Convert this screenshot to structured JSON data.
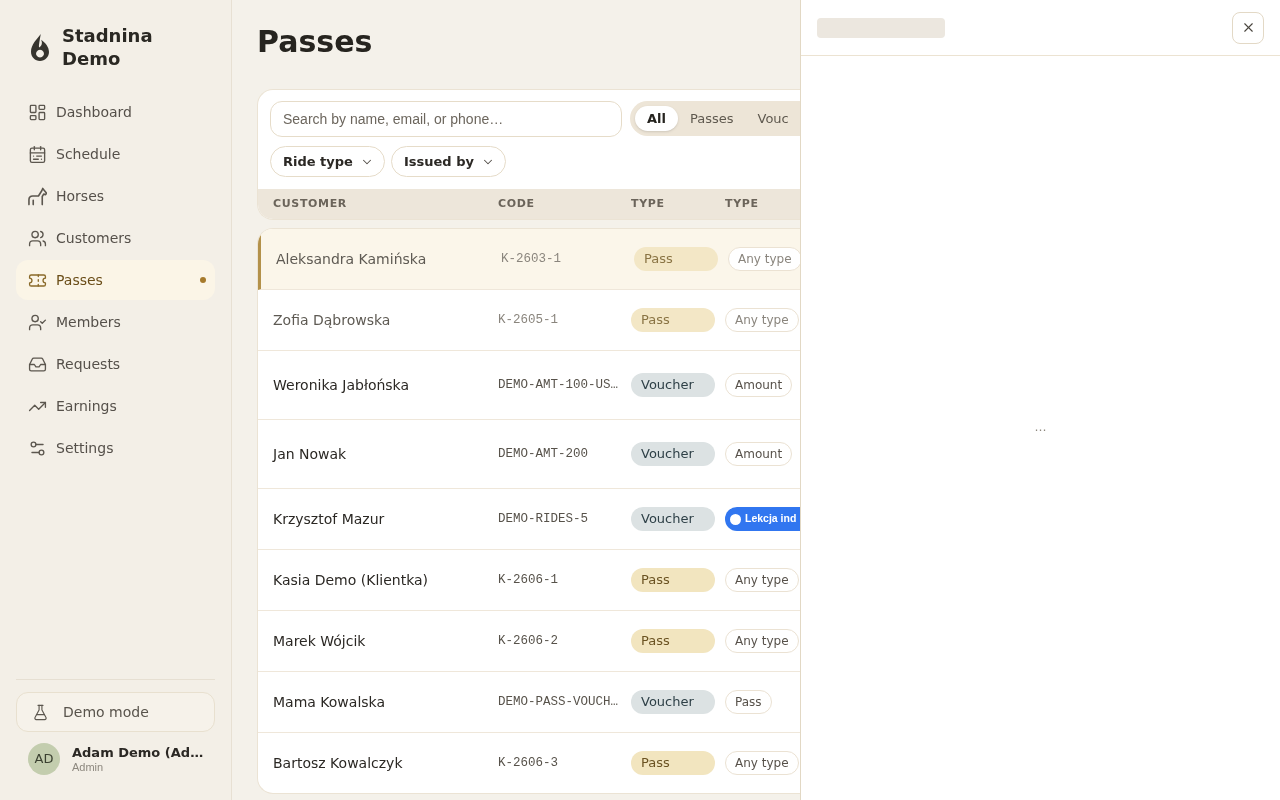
{
  "sidebar": {
    "brand": "Stadnina Demo",
    "items": [
      {
        "label": "Dashboard",
        "selected": false,
        "dot": false
      },
      {
        "label": "Schedule",
        "selected": false,
        "dot": false
      },
      {
        "label": "Horses",
        "selected": false,
        "dot": false
      },
      {
        "label": "Customers",
        "selected": false,
        "dot": false
      },
      {
        "label": "Passes",
        "selected": true,
        "dot": true
      },
      {
        "label": "Members",
        "selected": false,
        "dot": false
      },
      {
        "label": "Requests",
        "selected": false,
        "dot": false
      },
      {
        "label": "Earnings",
        "selected": false,
        "dot": false
      },
      {
        "label": "Settings",
        "selected": false,
        "dot": false
      }
    ],
    "demo_button": "Demo mode",
    "user": {
      "initials": "AD",
      "name": "Adam Demo (Ad…",
      "role": "Admin"
    }
  },
  "page": {
    "title": "Passes"
  },
  "toolbar": {
    "search": {
      "placeholder": "Search by name, email, or phone…"
    },
    "segments": [
      {
        "label": "All",
        "selected": true
      },
      {
        "label": "Passes",
        "selected": false
      },
      {
        "label": "Vouc",
        "selected": false
      }
    ],
    "filters": [
      "Ride type",
      "Issued by"
    ]
  },
  "table": {
    "columns": [
      "CUSTOMER",
      "CODE",
      "TYPE",
      "TYPE"
    ],
    "rows": [
      {
        "customer": "Aleksandra Kamińska",
        "code": "K-2603-1",
        "type": {
          "kind": "pass",
          "label": "Pass"
        },
        "type_2": {
          "kind": "outline",
          "label": "Any type"
        },
        "selected": true,
        "dimmed": true
      },
      {
        "customer": "Zofia Dąbrowska",
        "code": "K-2605-1",
        "type": {
          "kind": "pass",
          "label": "Pass"
        },
        "type_2": {
          "kind": "outline",
          "label": "Any type"
        },
        "selected": false,
        "dimmed": true
      },
      {
        "customer": "Weronika Jabłońska",
        "code": "DEMO-AMT-100-US…",
        "type": {
          "kind": "voucher",
          "label": "Voucher"
        },
        "type_2": {
          "kind": "outline",
          "label": "Amount"
        },
        "selected": false,
        "dimmed": false
      },
      {
        "customer": "Jan Nowak",
        "code": "DEMO-AMT-200",
        "type": {
          "kind": "voucher",
          "label": "Voucher"
        },
        "type_2": {
          "kind": "outline",
          "label": "Amount"
        },
        "selected": false,
        "dimmed": false
      },
      {
        "customer": "Krzysztof Mazur",
        "code": "DEMO-RIDES-5",
        "type": {
          "kind": "voucher",
          "label": "Voucher"
        },
        "type_2": {
          "kind": "ride",
          "label": "Lekcja ind",
          "color": "#3176f0"
        },
        "selected": false,
        "dimmed": false
      },
      {
        "customer": "Kasia Demo (Klientka)",
        "code": "K-2606-1",
        "type": {
          "kind": "pass",
          "label": "Pass"
        },
        "type_2": {
          "kind": "outline",
          "label": "Any type"
        },
        "selected": false,
        "dimmed": false
      },
      {
        "customer": "Marek Wójcik",
        "code": "K-2606-2",
        "type": {
          "kind": "pass",
          "label": "Pass"
        },
        "type_2": {
          "kind": "outline",
          "label": "Any type"
        },
        "selected": false,
        "dimmed": false
      },
      {
        "customer": "Mama Kowalska",
        "code": "DEMO-PASS-VOUCH…",
        "type": {
          "kind": "voucher",
          "label": "Voucher"
        },
        "type_2": {
          "kind": "outline",
          "label": "Pass"
        },
        "selected": false,
        "dimmed": false
      },
      {
        "customer": "Bartosz Kowalczyk",
        "code": "K-2606-3",
        "type": {
          "kind": "pass",
          "label": "Pass"
        },
        "type_2": {
          "kind": "outline",
          "label": "Any type"
        },
        "selected": false,
        "dimmed": false
      }
    ]
  },
  "panel": {
    "loading_text": "…"
  }
}
